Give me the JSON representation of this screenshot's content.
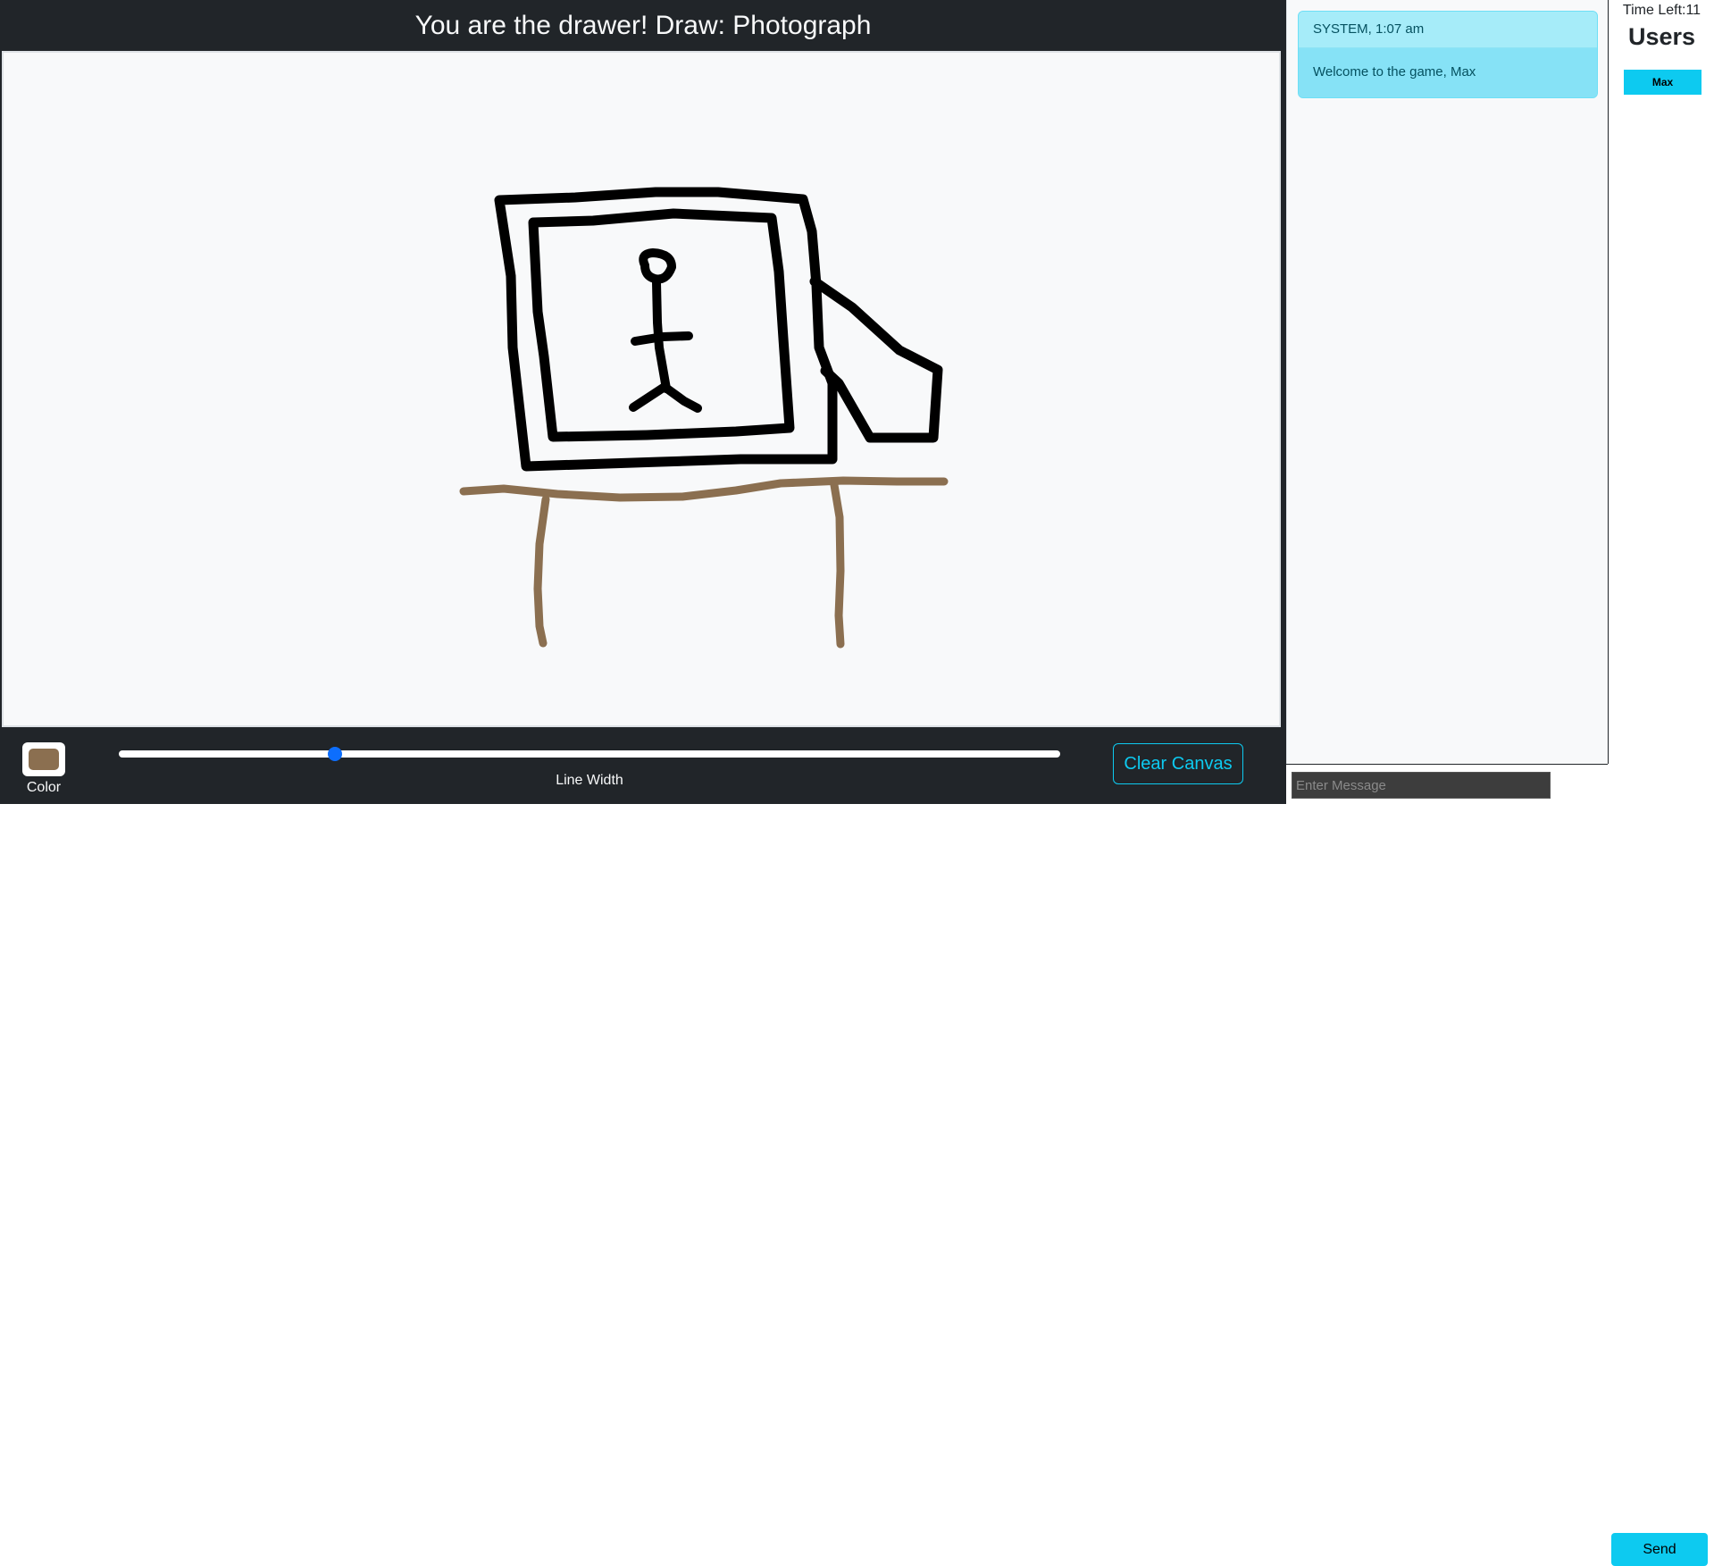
{
  "header": {
    "title": "You are the drawer! Draw: Photograph"
  },
  "toolbar": {
    "color_label": "Color",
    "current_color": "#8b6f50",
    "line_width_label": "Line Width",
    "line_width_fraction": 0.23,
    "clear_label": "Clear Canvas"
  },
  "chat": {
    "messages": [
      {
        "sender_time": "SYSTEM, 1:07 am",
        "text": "Welcome to the game, Max"
      }
    ],
    "input_placeholder": "Enter Message",
    "send_label": "Send"
  },
  "users_panel": {
    "time_left": "Time Left:11",
    "title": "Users",
    "users": [
      "Max"
    ]
  },
  "colors": {
    "black_stroke": "#000000",
    "brown_stroke": "#8b6f50",
    "accent": "#0dcaf0",
    "slider": "#0d6efd"
  }
}
